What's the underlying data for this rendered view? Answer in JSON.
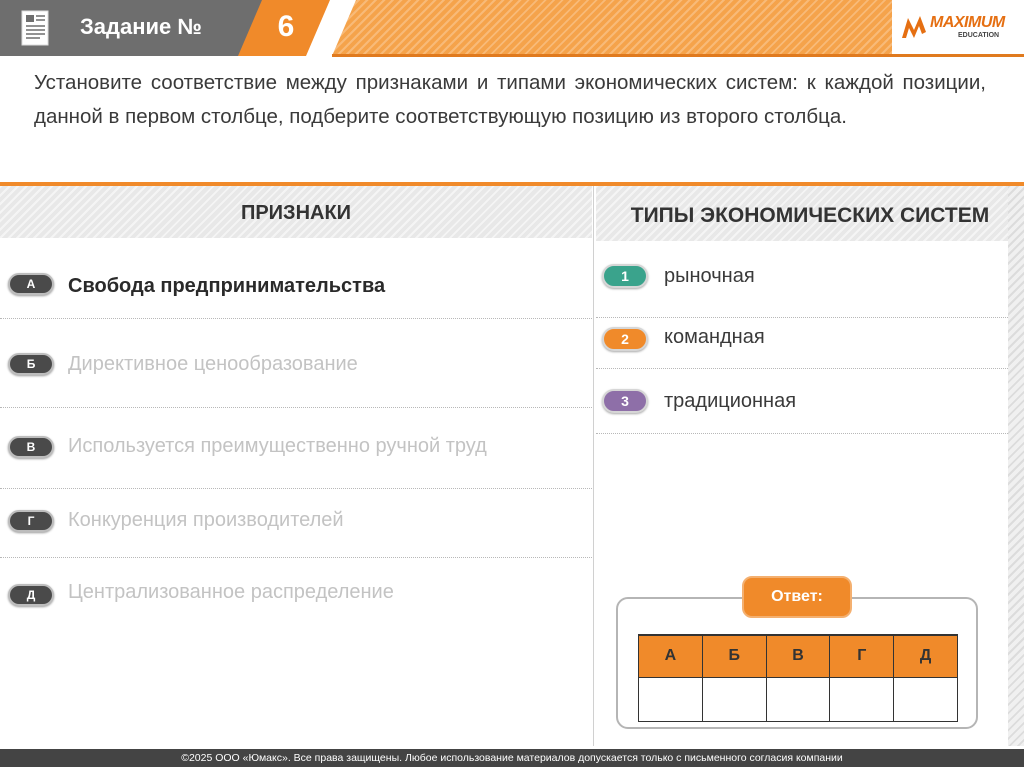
{
  "header": {
    "title": "Задание №",
    "number": "6",
    "logo_text": "MAXIMUM",
    "logo_sub": "EDUCATION"
  },
  "question": "Установите соответствие между признаками и типами экономических систем: к каждой позиции, данной в первом столбце, подберите соответствующую позицию из второго столбца.",
  "columns": {
    "left_title": "ПРИЗНАКИ",
    "right_title": "ТИПЫ ЭКОНОМИЧЕСКИХ СИСТЕМ"
  },
  "features": [
    {
      "letter": "А",
      "text": "Свобода предпринимательства",
      "state": "active"
    },
    {
      "letter": "Б",
      "text": "Директивное ценообразование",
      "state": "dim"
    },
    {
      "letter": "В",
      "text": "Используется преимущественно ручной труд",
      "state": "dim"
    },
    {
      "letter": "Г",
      "text": "Конкуренция производителей",
      "state": "dim"
    },
    {
      "letter": "Д",
      "text": "Централизованное распределение",
      "state": "dim"
    }
  ],
  "types": [
    {
      "num": "1",
      "text": "рыночная",
      "color": "#3aa38c"
    },
    {
      "num": "2",
      "text": "командная",
      "color": "#f08a2a"
    },
    {
      "num": "3",
      "text": "традиционная",
      "color": "#8e6fa8"
    }
  ],
  "answer": {
    "label": "Ответ:",
    "headers": [
      "А",
      "Б",
      "В",
      "Г",
      "Д"
    ]
  },
  "footer": "©2025 ООО «Юмакс». Все права защищены. Любое использование материалов допускается только с письменного согласия компании"
}
